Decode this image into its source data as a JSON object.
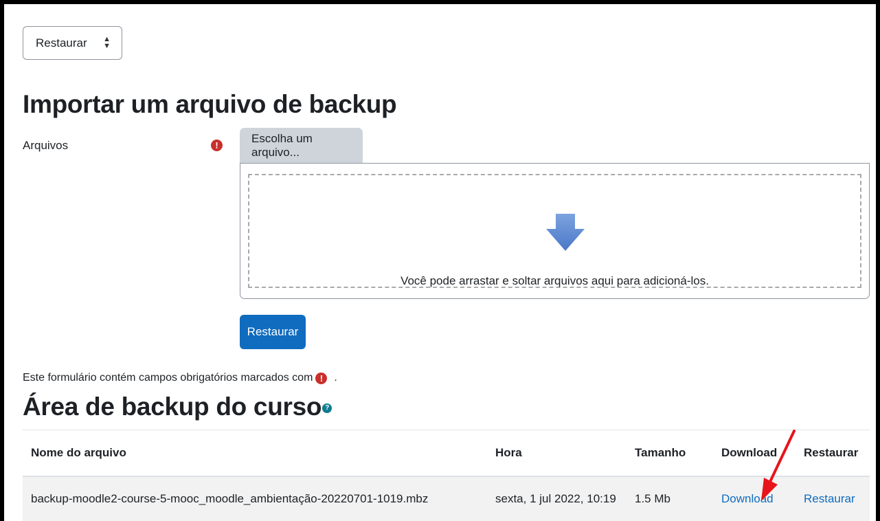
{
  "action_select": {
    "value": "Restaurar"
  },
  "import": {
    "title": "Importar um arquivo de backup",
    "files_label": "Arquivos",
    "choose_button": "Escolha um arquivo...",
    "drop_text": "Você pode arrastar e soltar arquivos aqui para adicioná-los.",
    "submit_button": "Restaurar",
    "required_note": "Este formulário contém campos obrigatórios marcados com",
    "required_note_end": "."
  },
  "backup_area": {
    "title": "Área de backup do curso",
    "columns": [
      "Nome do arquivo",
      "Hora",
      "Tamanho",
      "Download",
      "Restaurar"
    ],
    "rows": [
      {
        "name": "backup-moodle2-course-5-mooc_moodle_ambientação-20220701-1019.mbz",
        "time": "sexta, 1 jul 2022, 10:19",
        "size": "1.5 Mb",
        "download": "Download",
        "restore": "Restaurar"
      }
    ]
  },
  "colors": {
    "primary": "#0f6cbf",
    "required": "#c9302c",
    "annotation_arrow": "#e8141b"
  },
  "icons": {
    "required": "exclamation-circle-icon",
    "help": "question-circle-icon",
    "drop": "arrow-down-icon"
  }
}
